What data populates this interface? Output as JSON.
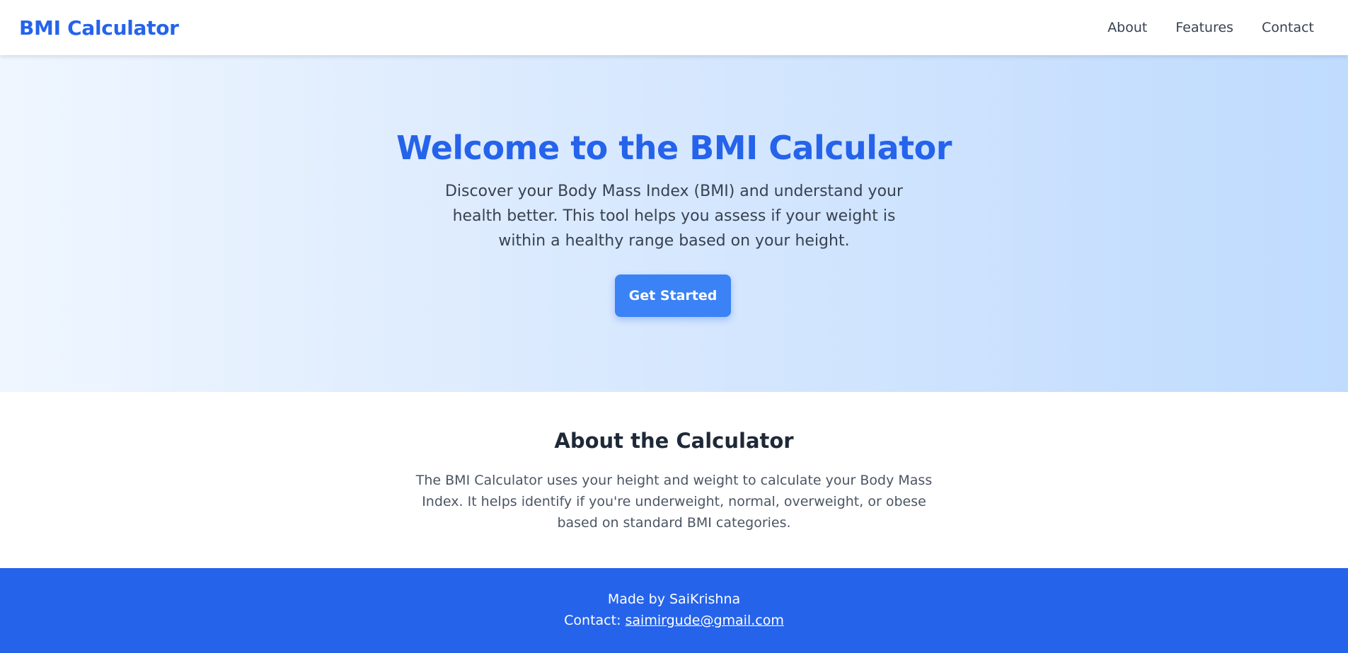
{
  "header": {
    "brand": "BMI Calculator",
    "nav": [
      {
        "label": "About"
      },
      {
        "label": "Features"
      },
      {
        "label": "Contact"
      }
    ]
  },
  "hero": {
    "title": "Welcome to the BMI Calculator",
    "description": "Discover your Body Mass Index (BMI) and understand your health better. This tool helps you assess if your weight is within a healthy range based on your height.",
    "cta_label": "Get Started"
  },
  "about": {
    "title": "About the Calculator",
    "description": "The BMI Calculator uses your height and weight to calculate your Body Mass Index. It helps identify if you're underweight, normal, overweight, or obese based on standard BMI categories."
  },
  "footer": {
    "made_by": "Made by SaiKrishna",
    "contact_prefix": "Contact: ",
    "email": "saimirgude@gmail.com"
  },
  "colors": {
    "primary": "#2563eb",
    "button": "#3b82f6",
    "text_dark": "#1f2937",
    "text_body": "#374151"
  }
}
